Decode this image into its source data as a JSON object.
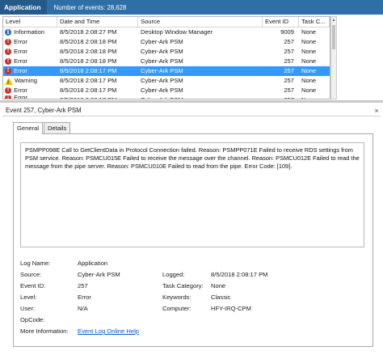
{
  "titlebar": {
    "title": "Application",
    "count": "Number of events: 28,628"
  },
  "events": {
    "columns": [
      "Level",
      "Date and Time",
      "Source",
      "Event ID",
      "Task C..."
    ],
    "rows": [
      {
        "level": "Information",
        "icon": "info-icon",
        "date": "8/5/2018 2:08:27 PM",
        "source": "Desktop Window Manager",
        "id": "9009",
        "task": "None"
      },
      {
        "level": "Error",
        "icon": "error-icon",
        "date": "8/5/2018 2:08:18 PM",
        "source": "Cyber-Ark PSM",
        "id": "257",
        "task": "None"
      },
      {
        "level": "Error",
        "icon": "error-icon",
        "date": "8/5/2018 2:08:18 PM",
        "source": "Cyber-Ark PSM",
        "id": "257",
        "task": "None"
      },
      {
        "level": "Error",
        "icon": "error-icon",
        "date": "8/5/2018 2:08:18 PM",
        "source": "Cyber-Ark PSM",
        "id": "257",
        "task": "None"
      },
      {
        "level": "Error",
        "icon": "error-icon",
        "date": "8/5/2018 2:08:17 PM",
        "source": "Cyber-Ark PSM",
        "id": "257",
        "task": "None"
      },
      {
        "level": "Warning",
        "icon": "warning-icon",
        "date": "8/5/2018 2:08:17 PM",
        "source": "Cyber-Ark PSM",
        "id": "257",
        "task": "None"
      },
      {
        "level": "Error",
        "icon": "error-icon",
        "date": "8/5/2018 2:08:17 PM",
        "source": "Cyber-Ark PSM",
        "id": "257",
        "task": "None"
      },
      {
        "level": "Error",
        "icon": "error-icon",
        "date": "8/5/2018 2:08:17 PM",
        "source": "Cyber-Ark PSM",
        "id": "257",
        "task": "None"
      }
    ],
    "selected_index": 4
  },
  "detail": {
    "title": "Event 257, Cyber-Ark PSM",
    "tabs": [
      "General",
      "Details"
    ],
    "message": "PSMPP098E Call to GetClientData in Protocol Connection failed. Reason: PSMPP071E Failed to receive RDS settings from PSM service. Reason: PSMCU015E Failed to receive the message over the channel. Reason: PSMCU012E Failed to read the message from the pipe server. Reason: PSMCU010E Failed to read from the pipe. Error Code: [109].",
    "props": {
      "log_name_label": "Log Name:",
      "log_name": "Application",
      "source_label": "Source:",
      "source": "Cyber-Ark PSM",
      "logged_label": "Logged:",
      "logged": "8/5/2018 2:08:17 PM",
      "event_id_label": "Event ID:",
      "event_id": "257",
      "task_label": "Task Category:",
      "task": "None",
      "level_label": "Level:",
      "level": "Error",
      "keywords_label": "Keywords:",
      "keywords": "Classic",
      "user_label": "User:",
      "user": "N/A",
      "computer_label": "Computer:",
      "computer": "HFY-IRQ-CPM",
      "opcode_label": "OpCode:",
      "opcode": "",
      "more_info_label": "More Information:",
      "more_info_link": "Event Log Online Help"
    }
  },
  "colors": {
    "titlebar": "#2f6fa7",
    "selection": "#3399ff",
    "error": "#c92f2f",
    "info": "#2b6cc4",
    "warning": "#f2c200",
    "link": "#1155cc"
  }
}
